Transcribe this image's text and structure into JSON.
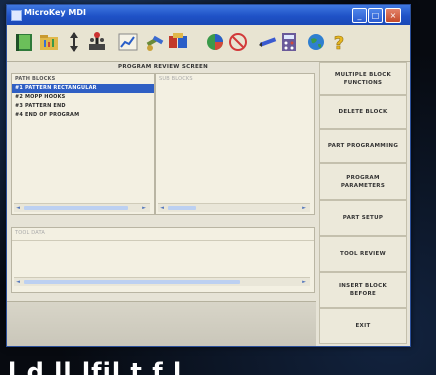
{
  "window": {
    "title": "MicroKey MDI",
    "minimize_glyph": "_",
    "maximize_glyph": "□",
    "close_glyph": "×"
  },
  "toolbar": {
    "tools": [
      {
        "icon": "book-icon"
      },
      {
        "icon": "folder-chart-icon"
      },
      {
        "icon": "axes-arrows-icon"
      },
      {
        "icon": "joystick-icon"
      },
      {
        "icon": "line-graph-icon"
      },
      {
        "icon": "tools-icon"
      },
      {
        "icon": "wrench-set-icon"
      },
      {
        "icon": "color-wheel-icon"
      },
      {
        "icon": "stop-sign-icon"
      },
      {
        "icon": "pencil-icon"
      },
      {
        "icon": "calculator-icon"
      },
      {
        "icon": "globe-icon"
      },
      {
        "icon": "help-icon"
      }
    ]
  },
  "panel": {
    "title": "PROGRAM REVIEW SCREEN"
  },
  "path_blocks": {
    "header": "PATH BLOCKS",
    "items": [
      {
        "label": "#1 PATTERN RECTANGULAR",
        "selected": true
      },
      {
        "label": "#2 MOPP HOOKS",
        "selected": false
      },
      {
        "label": "#3 PATTERN END",
        "selected": false
      },
      {
        "label": "#4 END OF PROGRAM",
        "selected": false
      }
    ],
    "scroll_left": "◄",
    "scroll_right": "►"
  },
  "sub_blocks": {
    "header": "SUB BLOCKS",
    "scroll_left": "◄",
    "scroll_right": "►"
  },
  "tool_data": {
    "header": "TOOL DATA",
    "scroll_left": "◄",
    "scroll_right": "►"
  },
  "side_buttons": {
    "multiple_block_functions": "MULTIPLE BLOCK\nFUNCTIONS",
    "delete_block": "DELETE BLOCK",
    "part_programming": "PART PROGRAMMING",
    "program_parameters": "PROGRAM\nPARAMETERS",
    "part_setup": "PART SETUP",
    "tool_review": "TOOL REVIEW",
    "insert_block_before": "INSERT BLOCK\nBEFORE",
    "exit": "EXIT"
  },
  "caption": {
    "text": "l    d    ll     lfil    t    f    l"
  },
  "colors": {
    "title_bar": "#1f52c7",
    "selection": "#2f5fc4",
    "window_bg": "#e6e3d6",
    "page_bg": "#070a10"
  }
}
